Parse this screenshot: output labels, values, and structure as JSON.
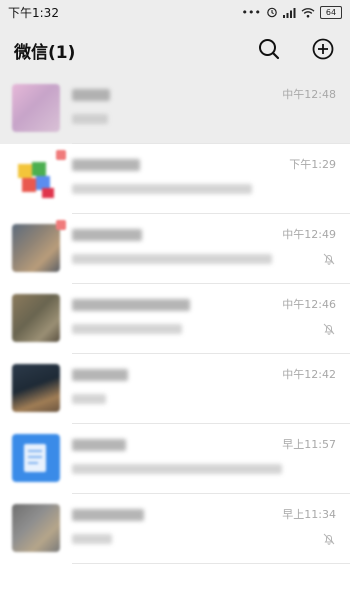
{
  "status": {
    "time": "下午1:32",
    "battery": "64",
    "icons": [
      "dots-icon",
      "alarm-icon",
      "signal-icon",
      "wifi-icon",
      "battery-icon"
    ]
  },
  "header": {
    "title": "微信(1)",
    "search_icon": "search-icon",
    "add_icon": "add-circle-icon"
  },
  "colors": {
    "header_bg": "#ededed",
    "pinned_row_bg": "#ededed",
    "timestamp": "#a8a8a8"
  },
  "chats": [
    {
      "time": "中午12:48",
      "pinned": true,
      "muted": false
    },
    {
      "time": "下午1:29",
      "pinned": false,
      "muted": false
    },
    {
      "time": "中午12:49",
      "pinned": false,
      "muted": true
    },
    {
      "time": "中午12:46",
      "pinned": false,
      "muted": true
    },
    {
      "time": "中午12:42",
      "pinned": false,
      "muted": false
    },
    {
      "time": "早上11:57",
      "pinned": false,
      "muted": false
    },
    {
      "time": "早上11:34",
      "pinned": false,
      "muted": true
    }
  ]
}
